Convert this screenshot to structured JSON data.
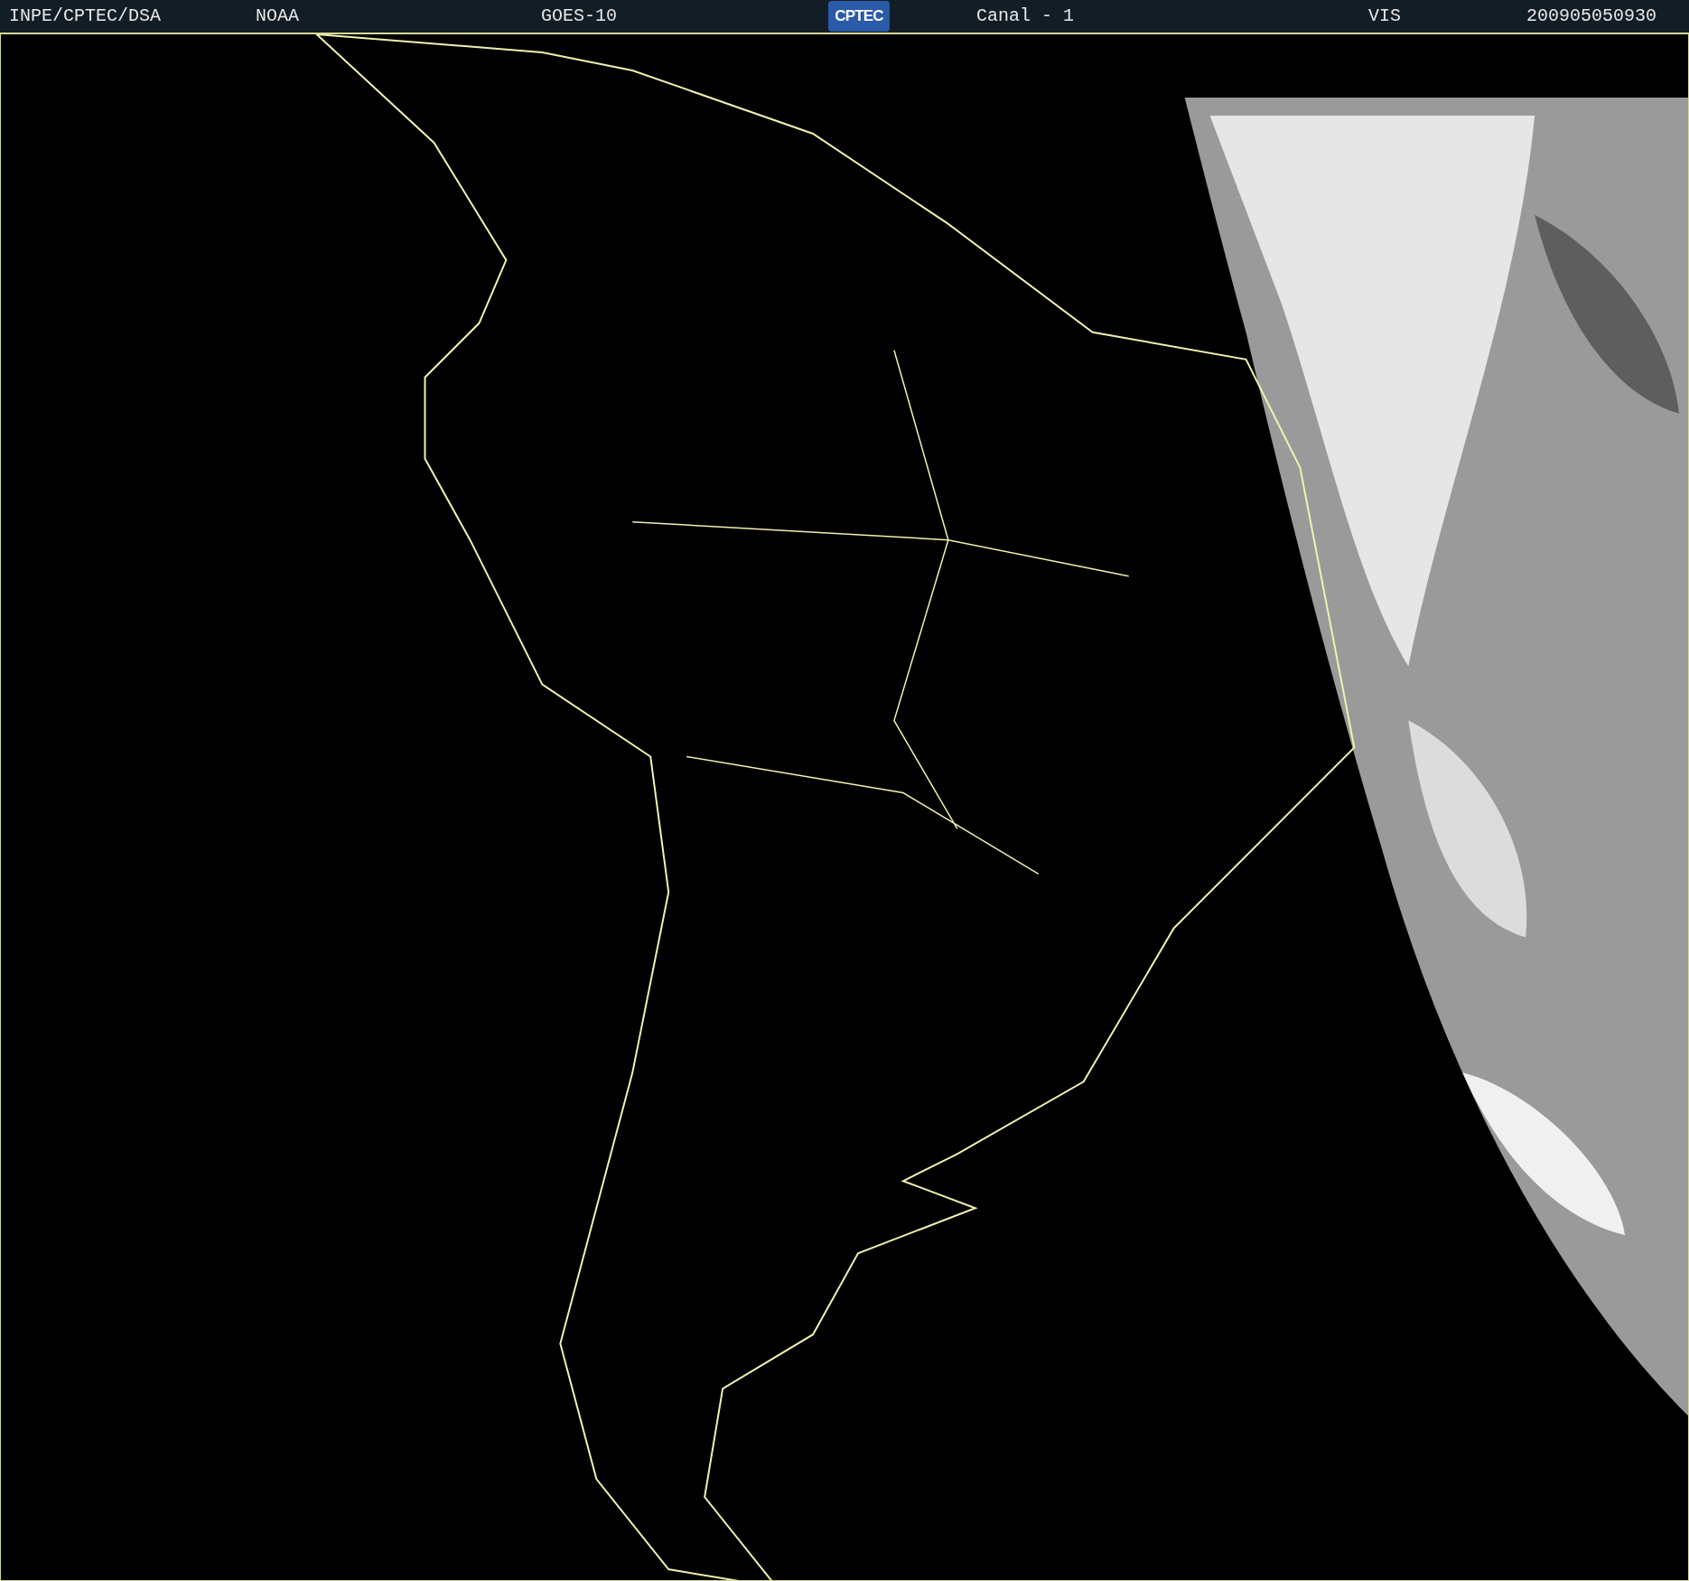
{
  "header": {
    "source": "INPE/CPTEC/DSA",
    "agency": "NOAA",
    "satellite": "GOES-10",
    "logo": "CPTEC",
    "channel": "Canal - 1",
    "band": "VIS",
    "timestamp": "200905050930"
  }
}
